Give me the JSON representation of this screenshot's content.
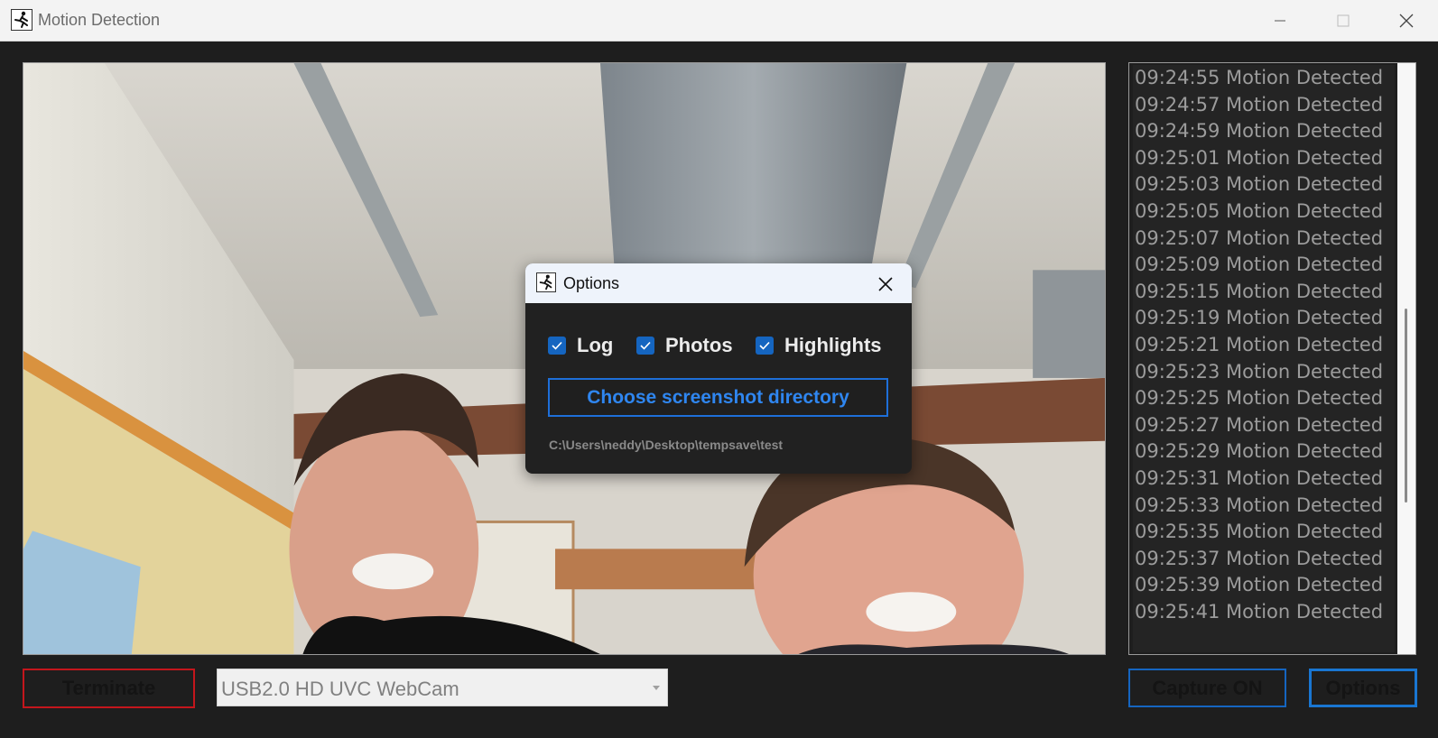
{
  "window": {
    "title": "Motion Detection",
    "icon": "running-man-icon"
  },
  "log": {
    "lines": [
      "09:24:55 Motion Detected",
      "09:24:57 Motion Detected",
      "09:24:59 Motion Detected",
      "09:25:01 Motion Detected",
      "09:25:03 Motion Detected",
      "09:25:05 Motion Detected",
      "09:25:07 Motion Detected",
      "09:25:09 Motion Detected",
      "09:25:15 Motion Detected",
      "09:25:19 Motion Detected",
      "09:25:21 Motion Detected",
      "09:25:23 Motion Detected",
      "09:25:25 Motion Detected",
      "09:25:27 Motion Detected",
      "09:25:29 Motion Detected",
      "09:25:31 Motion Detected",
      "09:25:33 Motion Detected",
      "09:25:35 Motion Detected",
      "09:25:37 Motion Detected",
      "09:25:39 Motion Detected",
      "09:25:41 Motion Detected"
    ],
    "scroll_position": 0.62,
    "scroll_visible_fraction": 0.33
  },
  "controls": {
    "terminate_label": "Terminate",
    "camera_selected": "USB2.0 HD UVC WebCam",
    "capture_label": "Capture ON",
    "options_label": "Options"
  },
  "options_dialog": {
    "title": "Options",
    "checkboxes": [
      {
        "label": "Log",
        "checked": true
      },
      {
        "label": "Photos",
        "checked": true
      },
      {
        "label": "Highlights",
        "checked": true
      }
    ],
    "choose_dir_label": "Choose screenshot directory",
    "directory_path": "C:\\Users\\neddy\\Desktop\\tempsave\\test"
  },
  "colors": {
    "background": "#1e1e1e",
    "accent_blue": "#1565c0",
    "terminate_red": "#c4161c",
    "log_text": "#9c9c9c"
  }
}
